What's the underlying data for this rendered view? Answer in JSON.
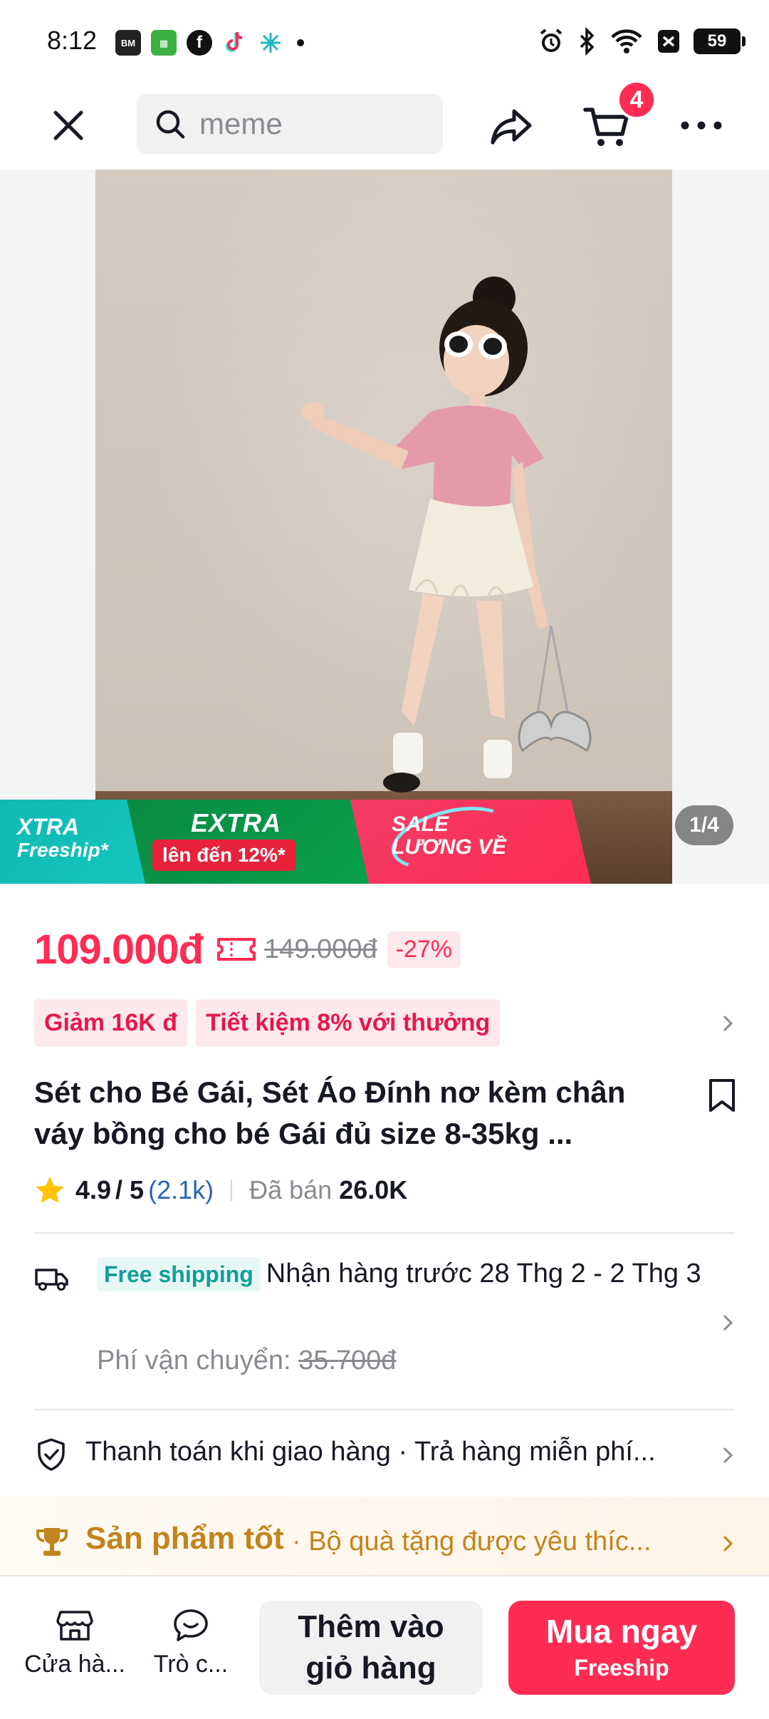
{
  "status_bar": {
    "time": "8:12",
    "battery": "59",
    "app_icons": [
      "baomoi-icon",
      "app-green-icon",
      "facebook-icon",
      "tiktok-icon",
      "perplexity-icon",
      "dot-icon"
    ],
    "system_icons": [
      "alarm-icon",
      "bluetooth-icon",
      "wifi-icon",
      "sim-icon",
      "battery-icon"
    ]
  },
  "top_nav": {
    "search_placeholder": "meme",
    "cart_count": "4"
  },
  "gallery": {
    "page_indicator": "1/4"
  },
  "promo": {
    "xtra_line1": "XTRA",
    "xtra_line2": "Freeship*",
    "extra_title": "EXTRA",
    "extra_sub": "lên đến 12%*",
    "sale_line1": "SALE",
    "sale_line2": "LƯƠNG VỀ"
  },
  "price": {
    "current": "109.000đ",
    "original": "149.000đ",
    "discount": "-27%"
  },
  "chips": [
    "Giảm 16K đ",
    "Tiết kiệm 8% với thưởng"
  ],
  "product": {
    "title": "Sét cho Bé Gái, Sét Áo Đính nơ kèm chân váy bồng cho bé Gái đủ size 8-35kg  ...",
    "rating": "4.9",
    "rating_max": "/ 5",
    "review_count": "(2.1k)",
    "sold_label": "Đã bán",
    "sold_value": "26.0K"
  },
  "shipping": {
    "badge": "Free shipping",
    "text": "Nhận hàng trước 28 Thg 2 - 2 Thg 3",
    "fee_label": "Phí vận chuyển:",
    "fee_old": "35.700đ"
  },
  "payment": {
    "text": "Thanh toán khi giao hàng · Trả hàng miễn phí..."
  },
  "good_product": {
    "title": "Sản phẩm tốt",
    "subtitle": "· Bộ quà tặng được yêu thíc..."
  },
  "bottom_bar": {
    "shop_label": "Cửa hà...",
    "chat_label": "Trò c...",
    "add_to_cart": "Thêm vào giỏ hàng",
    "buy_now": "Mua ngay",
    "buy_now_sub": "Freeship"
  },
  "colors": {
    "accent": "#fe2c55",
    "teal": "#129e98",
    "gold": "#c2841d",
    "link": "#2b64b9"
  }
}
